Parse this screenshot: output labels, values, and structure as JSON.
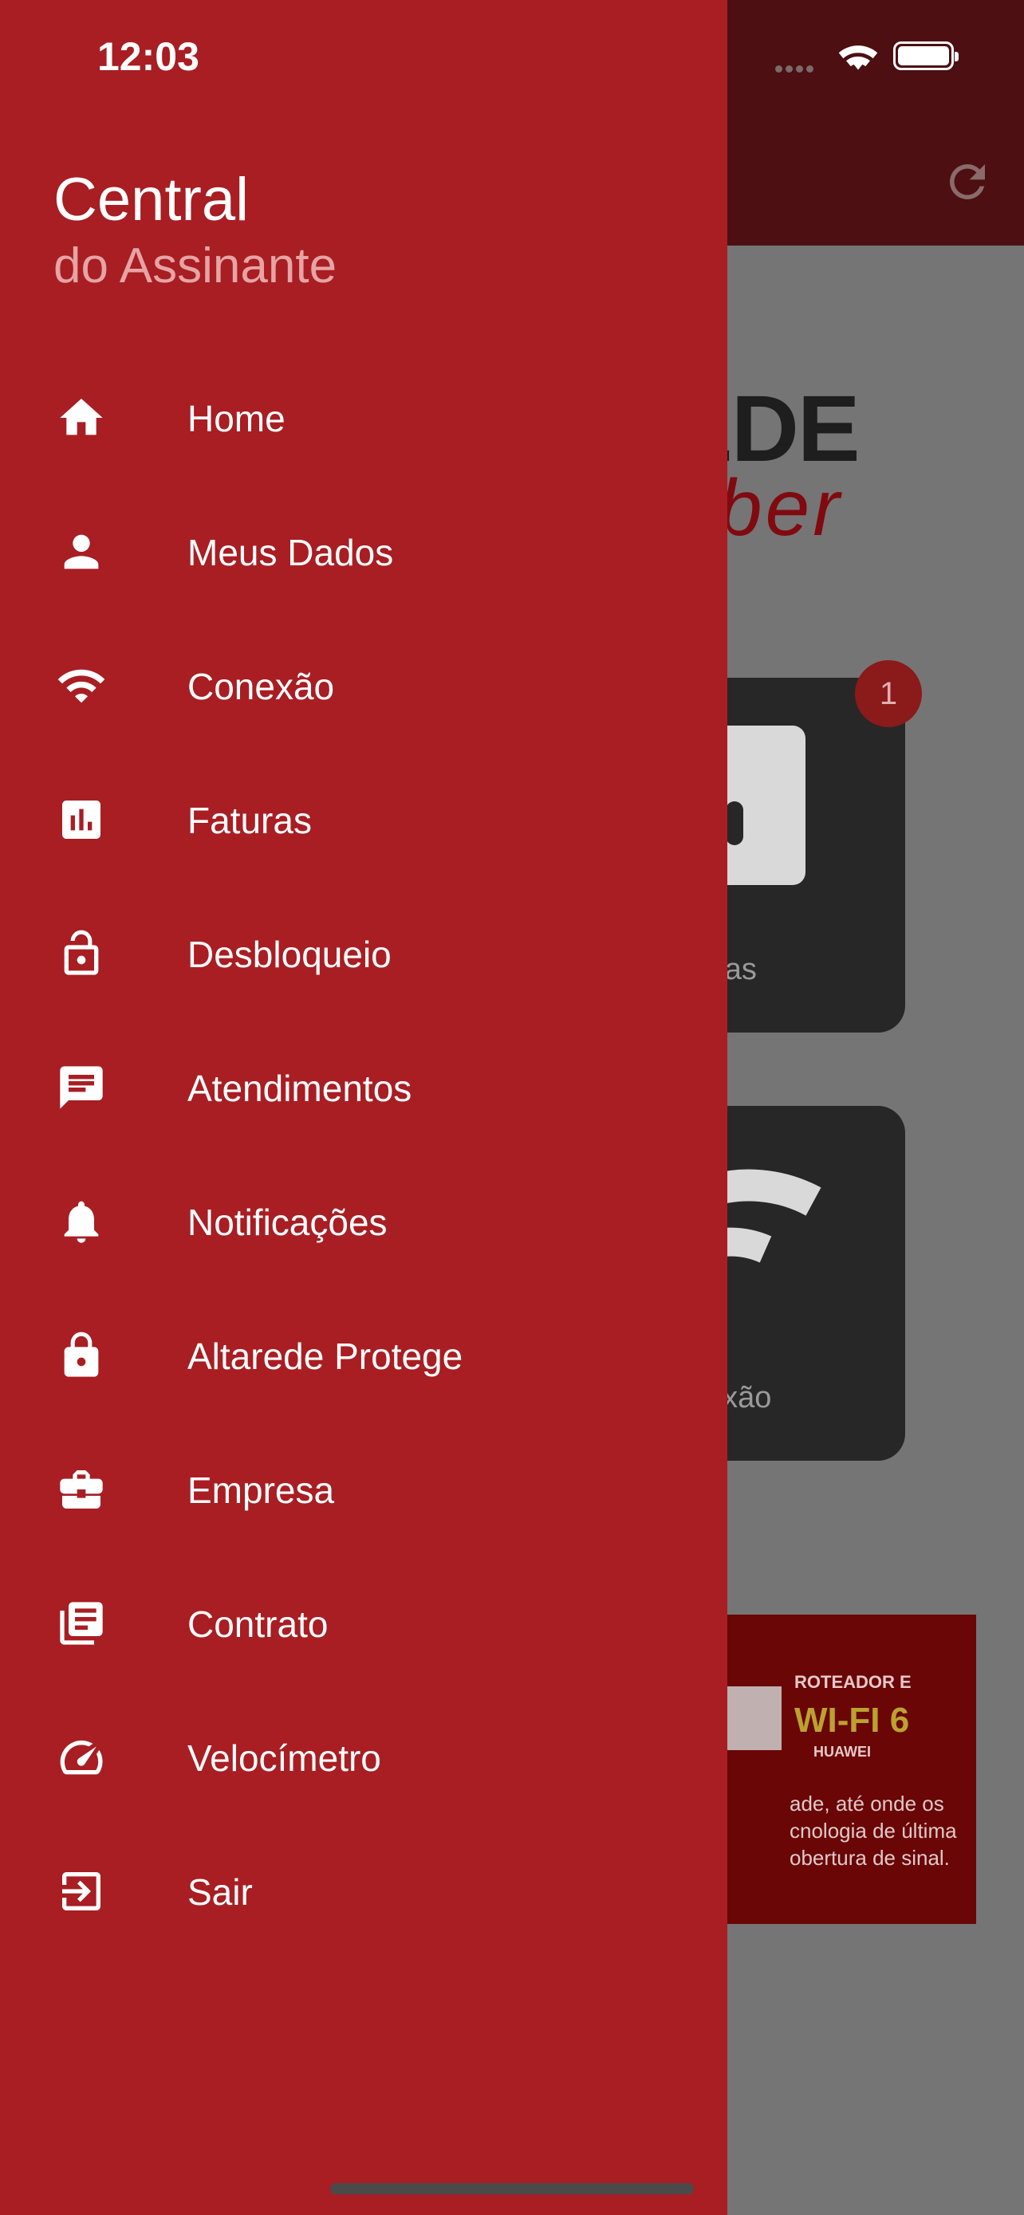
{
  "status_bar": {
    "time": "12:03"
  },
  "drawer": {
    "title": "Central",
    "subtitle": "do Assinante",
    "items": [
      {
        "label": "Home",
        "icon": "home-icon"
      },
      {
        "label": "Meus Dados",
        "icon": "person-icon"
      },
      {
        "label": "Conexão",
        "icon": "wifi-icon"
      },
      {
        "label": "Faturas",
        "icon": "bar-chart-icon"
      },
      {
        "label": "Desbloqueio",
        "icon": "unlock-icon"
      },
      {
        "label": "Atendimentos",
        "icon": "chat-icon"
      },
      {
        "label": "Notificações",
        "icon": "bell-icon"
      },
      {
        "label": "Altarede Protege",
        "icon": "lock-icon"
      },
      {
        "label": "Empresa",
        "icon": "briefcase-icon"
      },
      {
        "label": "Contrato",
        "icon": "document-icon"
      },
      {
        "label": "Velocímetro",
        "icon": "speedometer-icon"
      },
      {
        "label": "Sair",
        "icon": "exit-icon"
      }
    ]
  },
  "background": {
    "logo_text": "EDE",
    "logo_subtext": "ber",
    "badge_count": "1",
    "cards": [
      {
        "label": "uras"
      },
      {
        "label": "exão"
      }
    ],
    "banner": {
      "line1": "ROTEADOR E",
      "headline": "WI-FI 6",
      "brand": "HUAWEI",
      "body": "ade, até onde os cnologia de última obertura de sinal."
    }
  },
  "colors": {
    "drawer_bg": "#a81e23",
    "header_dim": "#4d0f12",
    "overlay": "#757575"
  }
}
